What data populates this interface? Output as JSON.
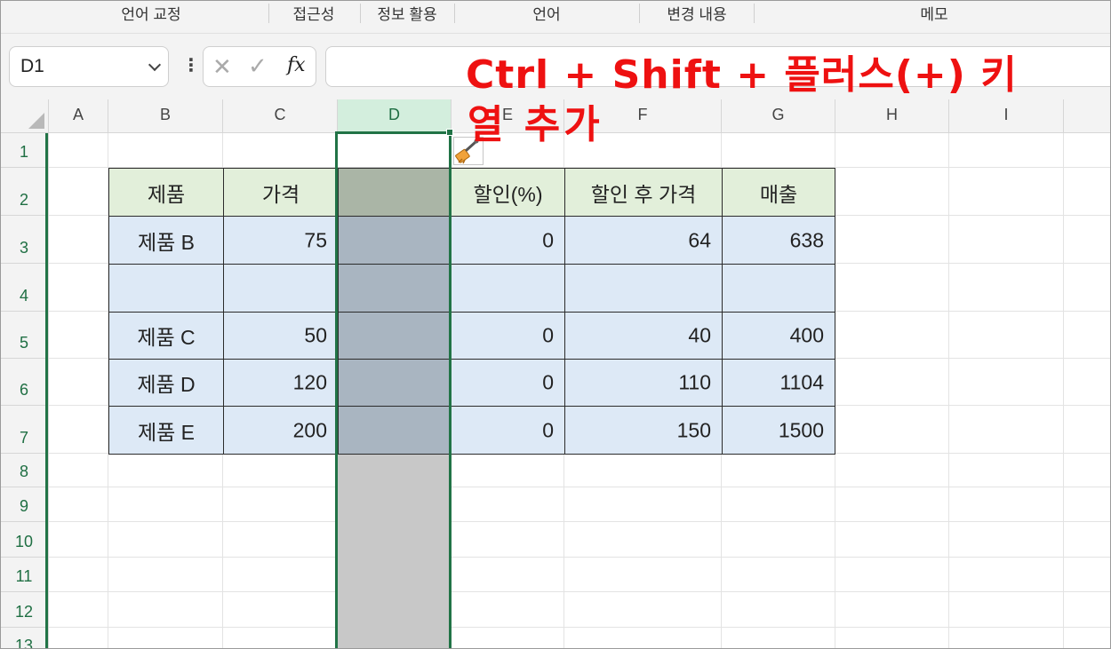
{
  "ribbon": {
    "groups": [
      "언어 교정",
      "접근성",
      "정보 활용",
      "언어",
      "변경 내용",
      "메모"
    ]
  },
  "formula_bar": {
    "name_box": "D1",
    "more_glyph": "⋮",
    "cancel_glyph": "✕",
    "enter_glyph": "✓",
    "fx_label": "fx",
    "formula_value": ""
  },
  "columns": [
    "A",
    "B",
    "C",
    "D",
    "E",
    "F",
    "G",
    "H",
    "I"
  ],
  "rows": [
    "1",
    "2",
    "3",
    "4",
    "5",
    "6",
    "7",
    "8",
    "9",
    "10",
    "11",
    "12",
    "13"
  ],
  "selected_column": "D",
  "table": {
    "headers": [
      "제품",
      "가격",
      "",
      "할인(%)",
      "할인 후 가격",
      "매출"
    ],
    "rows": [
      [
        "제품 B",
        "75",
        "",
        "0",
        "64",
        "638"
      ],
      [
        "",
        "",
        "",
        "",
        "",
        ""
      ],
      [
        "제품 C",
        "50",
        "",
        "0",
        "40",
        "400"
      ],
      [
        "제품 D",
        "120",
        "",
        "0",
        "110",
        "1104"
      ],
      [
        "제품 E",
        "200",
        "",
        "0",
        "150",
        "1500"
      ]
    ]
  },
  "annotation": {
    "line1": "Ctrl + Shift + 플러스(+) 키",
    "line2": "열 추가"
  },
  "icons": {
    "paste_options": "brush-icon"
  },
  "colors": {
    "excel_green": "#217346",
    "annotation_red": "#ee1111",
    "header_fill": "#e2efda",
    "body_fill": "#dde9f6"
  }
}
